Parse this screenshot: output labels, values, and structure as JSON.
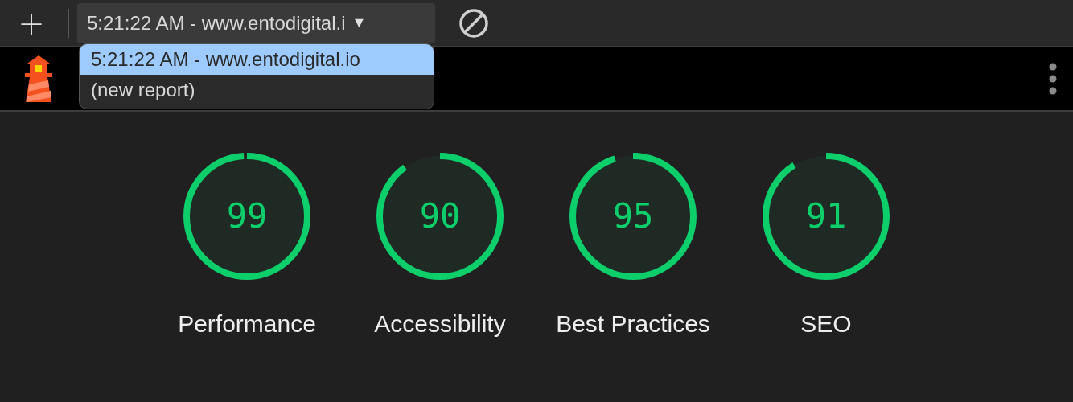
{
  "toolbar": {
    "add_button": "+",
    "report_select": {
      "value": "5:21:22 AM - www.entodigital.i",
      "caret": "▼"
    }
  },
  "report_menu": [
    {
      "label": "5:21:22 AM - www.entodigital.io",
      "selected": true
    },
    {
      "label": "(new report)",
      "selected": false
    }
  ],
  "gauges": [
    {
      "score": "99",
      "label": "Performance",
      "level": 0.99
    },
    {
      "score": "90",
      "label": "Accessibility",
      "level": 0.9
    },
    {
      "score": "95",
      "label": "Best Practices",
      "level": 0.95
    },
    {
      "score": "91",
      "label": "SEO",
      "level": 0.91
    }
  ]
}
